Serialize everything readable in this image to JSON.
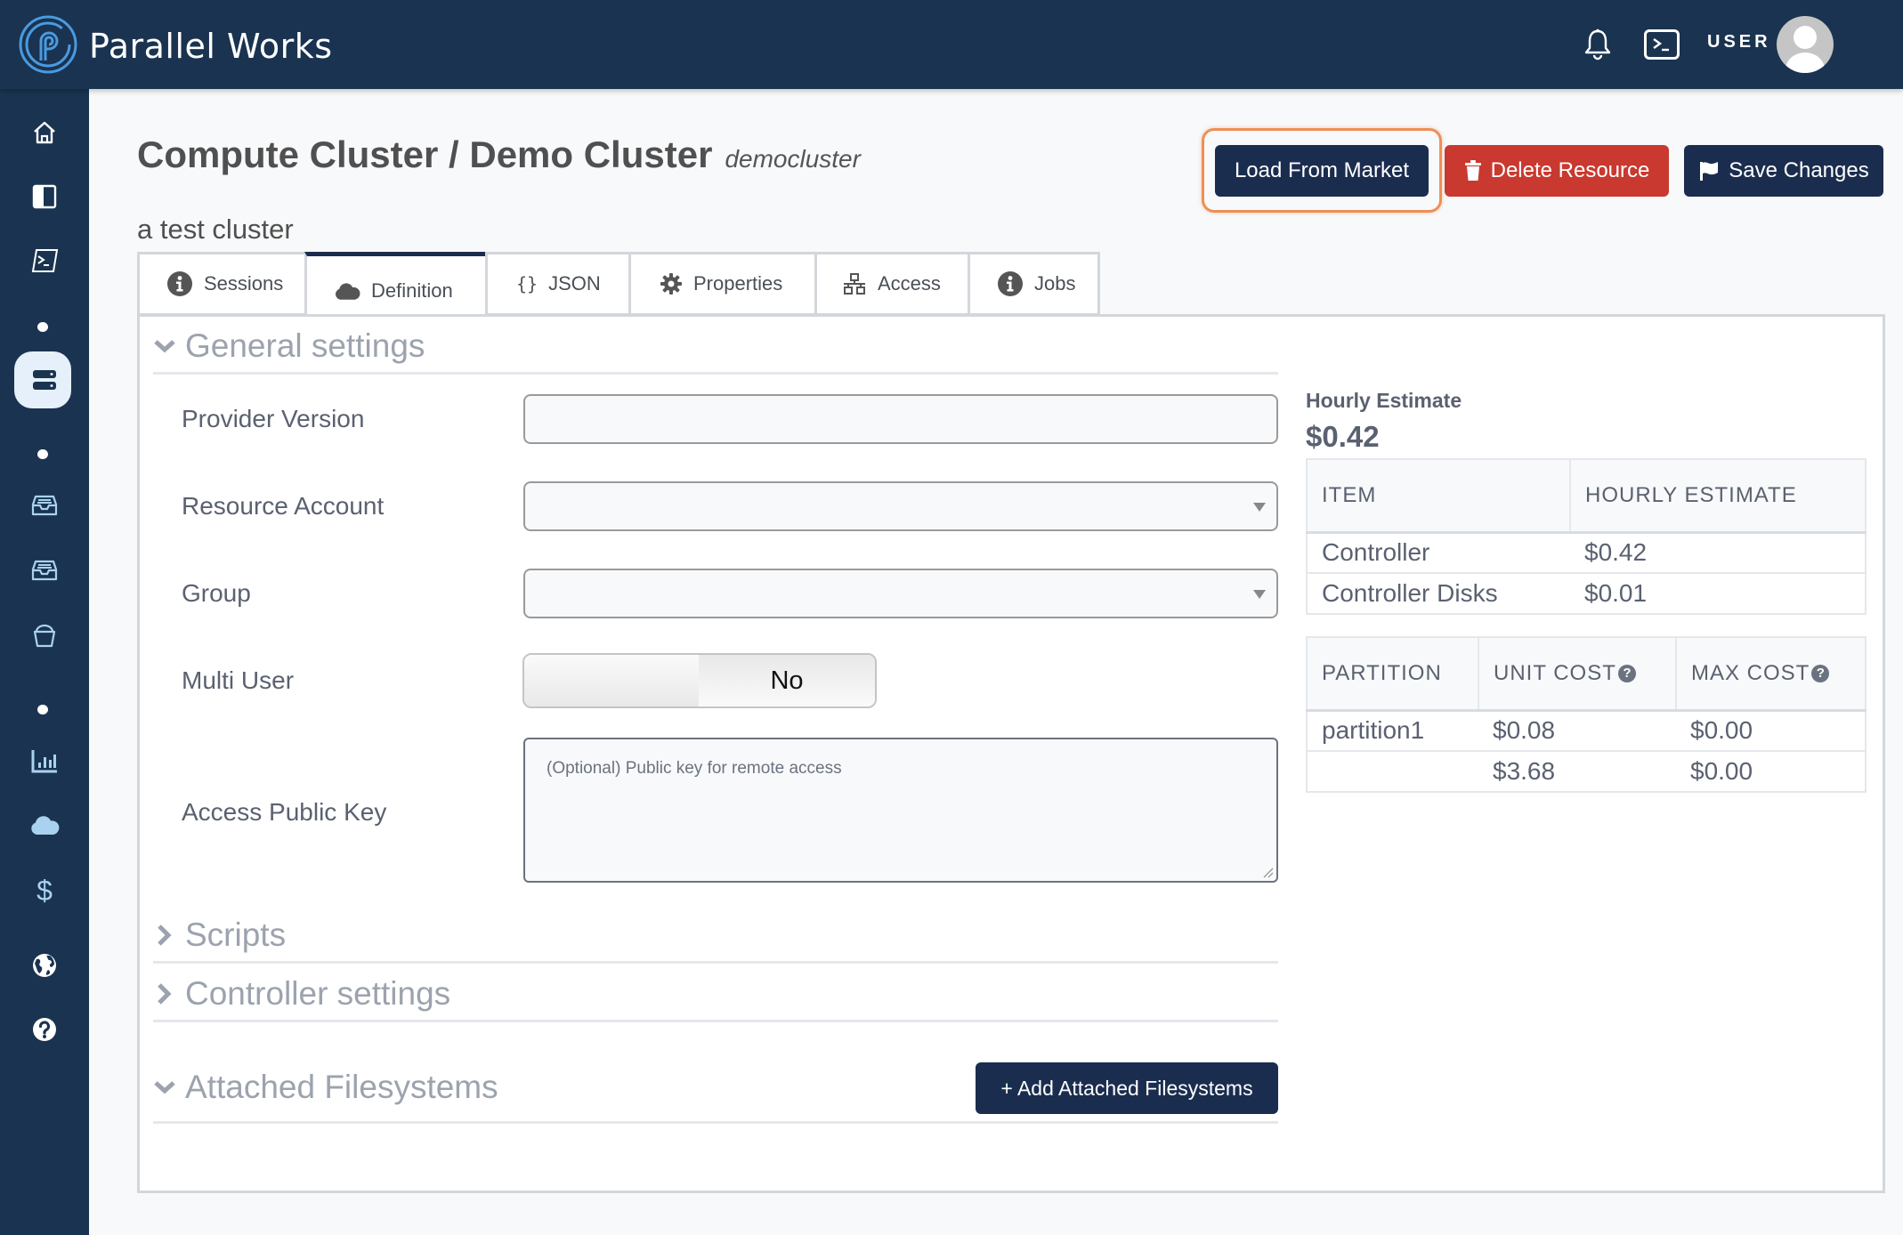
{
  "header": {
    "brand": "Parallel Works",
    "user_label": "USER"
  },
  "sidebar": {
    "items": [
      {
        "icon": "home-icon",
        "label": "Home"
      },
      {
        "icon": "editor-icon",
        "label": "Editor"
      },
      {
        "icon": "terminal-icon",
        "label": "Terminal"
      },
      {
        "icon": "server-icon",
        "label": "Compute",
        "active": true
      },
      {
        "icon": "storage-icon",
        "label": "Storage"
      },
      {
        "icon": "storage-alt-icon",
        "label": "Storage 2"
      },
      {
        "icon": "bucket-icon",
        "label": "Buckets"
      },
      {
        "icon": "chart-icon",
        "label": "Usage"
      },
      {
        "icon": "cloud-icon",
        "label": "Cloud"
      },
      {
        "icon": "dollar-icon",
        "label": "Cost"
      },
      {
        "icon": "globe-icon",
        "label": "Network"
      },
      {
        "icon": "help-icon",
        "label": "Help"
      }
    ]
  },
  "page": {
    "title": "Compute Cluster / Demo Cluster",
    "slug": "democluster",
    "description": "a test cluster"
  },
  "actions": {
    "load_market": "Load From Market",
    "delete": "Delete Resource",
    "save": "Save Changes"
  },
  "tabs": [
    {
      "label": "Sessions",
      "icon": "info-icon"
    },
    {
      "label": "Definition",
      "icon": "cloud-icon",
      "active": true
    },
    {
      "label": "JSON",
      "icon": "braces-icon"
    },
    {
      "label": "Properties",
      "icon": "gear-icon"
    },
    {
      "label": "Access",
      "icon": "network-icon"
    },
    {
      "label": "Jobs",
      "icon": "info-icon"
    }
  ],
  "sections": {
    "general": "General settings",
    "scripts": "Scripts",
    "controller": "Controller settings",
    "filesystems": "Attached Filesystems",
    "add_filesystems": "+ Add Attached Filesystems"
  },
  "form": {
    "provider_version": {
      "label": "Provider Version",
      "value": ""
    },
    "resource_account": {
      "label": "Resource Account",
      "value": ""
    },
    "group": {
      "label": "Group",
      "value": ""
    },
    "multi_user": {
      "label": "Multi User",
      "value": "No"
    },
    "public_key": {
      "label": "Access Public Key",
      "placeholder": "(Optional) Public key for remote access",
      "value": ""
    }
  },
  "estimate": {
    "label": "Hourly Estimate",
    "total": "$0.42",
    "items_table": {
      "headers": [
        "ITEM",
        "HOURLY ESTIMATE"
      ],
      "rows": [
        [
          "Controller",
          "$0.42"
        ],
        [
          "Controller Disks",
          "$0.01"
        ]
      ]
    },
    "partition_table": {
      "headers": [
        "PARTITION",
        "UNIT COST",
        "MAX COST"
      ],
      "rows": [
        [
          "partition1",
          "$0.08",
          "$0.00"
        ],
        [
          "",
          "$3.68",
          "$0.00"
        ]
      ]
    }
  }
}
